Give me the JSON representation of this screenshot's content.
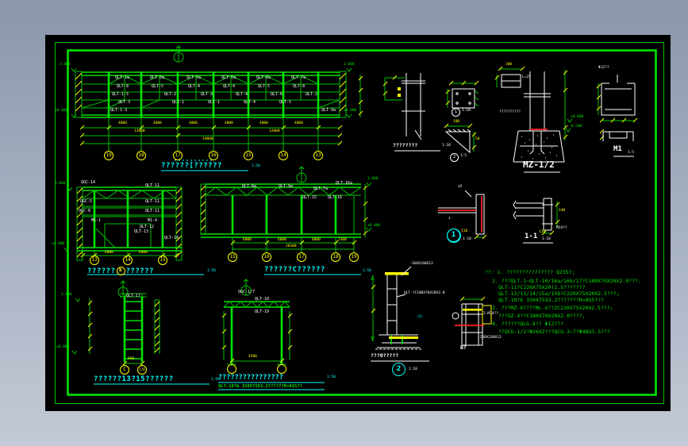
{
  "plan": {
    "title": "??????[??????",
    "scale": "1:50",
    "bubbles": [
      "19",
      "18",
      "17",
      "16",
      "15",
      "14",
      "13"
    ],
    "members": [
      "QLT-1a",
      "QLT-5a",
      "QLT-5a",
      "QLT-5a",
      "QLT-6a",
      "QLT-7a",
      "QLT-8",
      "QLT-5",
      "QLT-4",
      "QLT-4",
      "QLT-5",
      "QLT-8",
      "QLT-1-5",
      "QLT-2",
      "QLT-3",
      "QLT-4",
      "QLT-6",
      "QLT-2",
      "QLT-3",
      "QLT-1",
      "QLT-1",
      "QLT-4",
      "QLT-5",
      "QLT-1-3",
      "QLT-9a"
    ],
    "dims_top": [
      "4000",
      "4000",
      "4000",
      "4000",
      "4000",
      "4000"
    ],
    "dims_mid": [
      "12000",
      "12000"
    ],
    "dim_total": "24000",
    "level_top": "3.000",
    "level_bottom": "±0.000"
  },
  "elevB": {
    "title_pre": "??????",
    "axis": "B",
    "title_post": "??????",
    "scale": "1:50",
    "bubbles": [
      "13",
      "14",
      "15"
    ],
    "labels": [
      "QGC-14",
      "QLT-11",
      "QGC-5",
      "QLT-11",
      "QGC-6",
      "QLT-11",
      "M1-1",
      "M1-4",
      "QLT-12",
      "QLT-13",
      "QLT-14"
    ],
    "dims": [
      "6000",
      "6000"
    ],
    "level_top": "3.000",
    "level_bottom": "±0.000"
  },
  "elevC": {
    "title": "??????C??????",
    "scale": "1:50",
    "bubbles": [
      "15",
      "16",
      "17",
      "18",
      "19"
    ],
    "labels": [
      "QLT-8a",
      "QLT-9a",
      "QLT-7a",
      "QLT-16a",
      "QLT-15",
      "QLT-16"
    ],
    "dims": [
      "6000",
      "6000",
      "6000",
      "2300"
    ],
    "dim_total": "20300",
    "level_top": "3.000",
    "level_bottom": "±0.000"
  },
  "ladder": {
    "title": "??????13?15??????",
    "scale": "1:50",
    "member": "QLT-17",
    "bubbles": [
      "C",
      "1/B"
    ],
    "dim": "950",
    "level_top": "3.000",
    "level_bottom": "±0.000"
  },
  "portal": {
    "title": "????????????????",
    "scale": "1:50",
    "subtitle": "QLT-18?b 150X75X3.2??????R=855??",
    "labels": [
      "QGC-1/7",
      "QLT-18",
      "QLT-19"
    ],
    "dim": "4500"
  },
  "anchor": {
    "title": "???0?????",
    "detail_no": "2",
    "scale": "1:10",
    "leader1": "-160X160X12",
    "leader2": "QLT-?C180X70X20X2.0",
    "leader3": "(2)"
  },
  "bdetail": {
    "label": "B?",
    "leader1": "2-M24??",
    "leader2": "-240X240X12"
  },
  "coldetail": {
    "label": "????????",
    "scale": "1:10"
  },
  "plate": {
    "no": "1",
    "scale": "1:10"
  },
  "gusset": {
    "no": "2",
    "scale": "1:5",
    "dim_w": "100",
    "dim_h": "50"
  },
  "boxdetail": {
    "label": "L=25",
    "dim": "200"
  },
  "mz": {
    "label": "MZ-1/2",
    "hatch_note": "??????????",
    "level1": "±0.000",
    "level2": "-0.500"
  },
  "m1": {
    "label": "M1",
    "scale": "1:5",
    "note": "Φ12??"
  },
  "d1": {
    "no": "1",
    "scale": "1:10",
    "dim": "110",
    "weld": "a5",
    "sym": "⊥"
  },
  "d11": {
    "label": "1-1",
    "scale": "1:10",
    "dim_b": "110",
    "dim_r": "140",
    "note": "M24??"
  },
  "notes": {
    "lines": [
      "??:  1. ??????????????? Q235?;",
      "2. ???QLT-1~QLT-10/16a/16b/17?C180X70X20X2.0???.",
      "QLT-11?C220X75X20(2.5???????",
      "QLT-12/13/14/15a/15b?C220X75X20X2.5???;",
      "QLT-18?b  150X75X3.2???????R=855???",
      "3. ???MZ-X????ML-X??2C220X75X20X2.5???;",
      "???GZ-X??C180X70X20X2.0????,",
      "4. ??????QLG-X??  Φ12???",
      "??QCG-1/2?Φ26X2???QCG-3~7?Φ48X3.5???"
    ]
  }
}
